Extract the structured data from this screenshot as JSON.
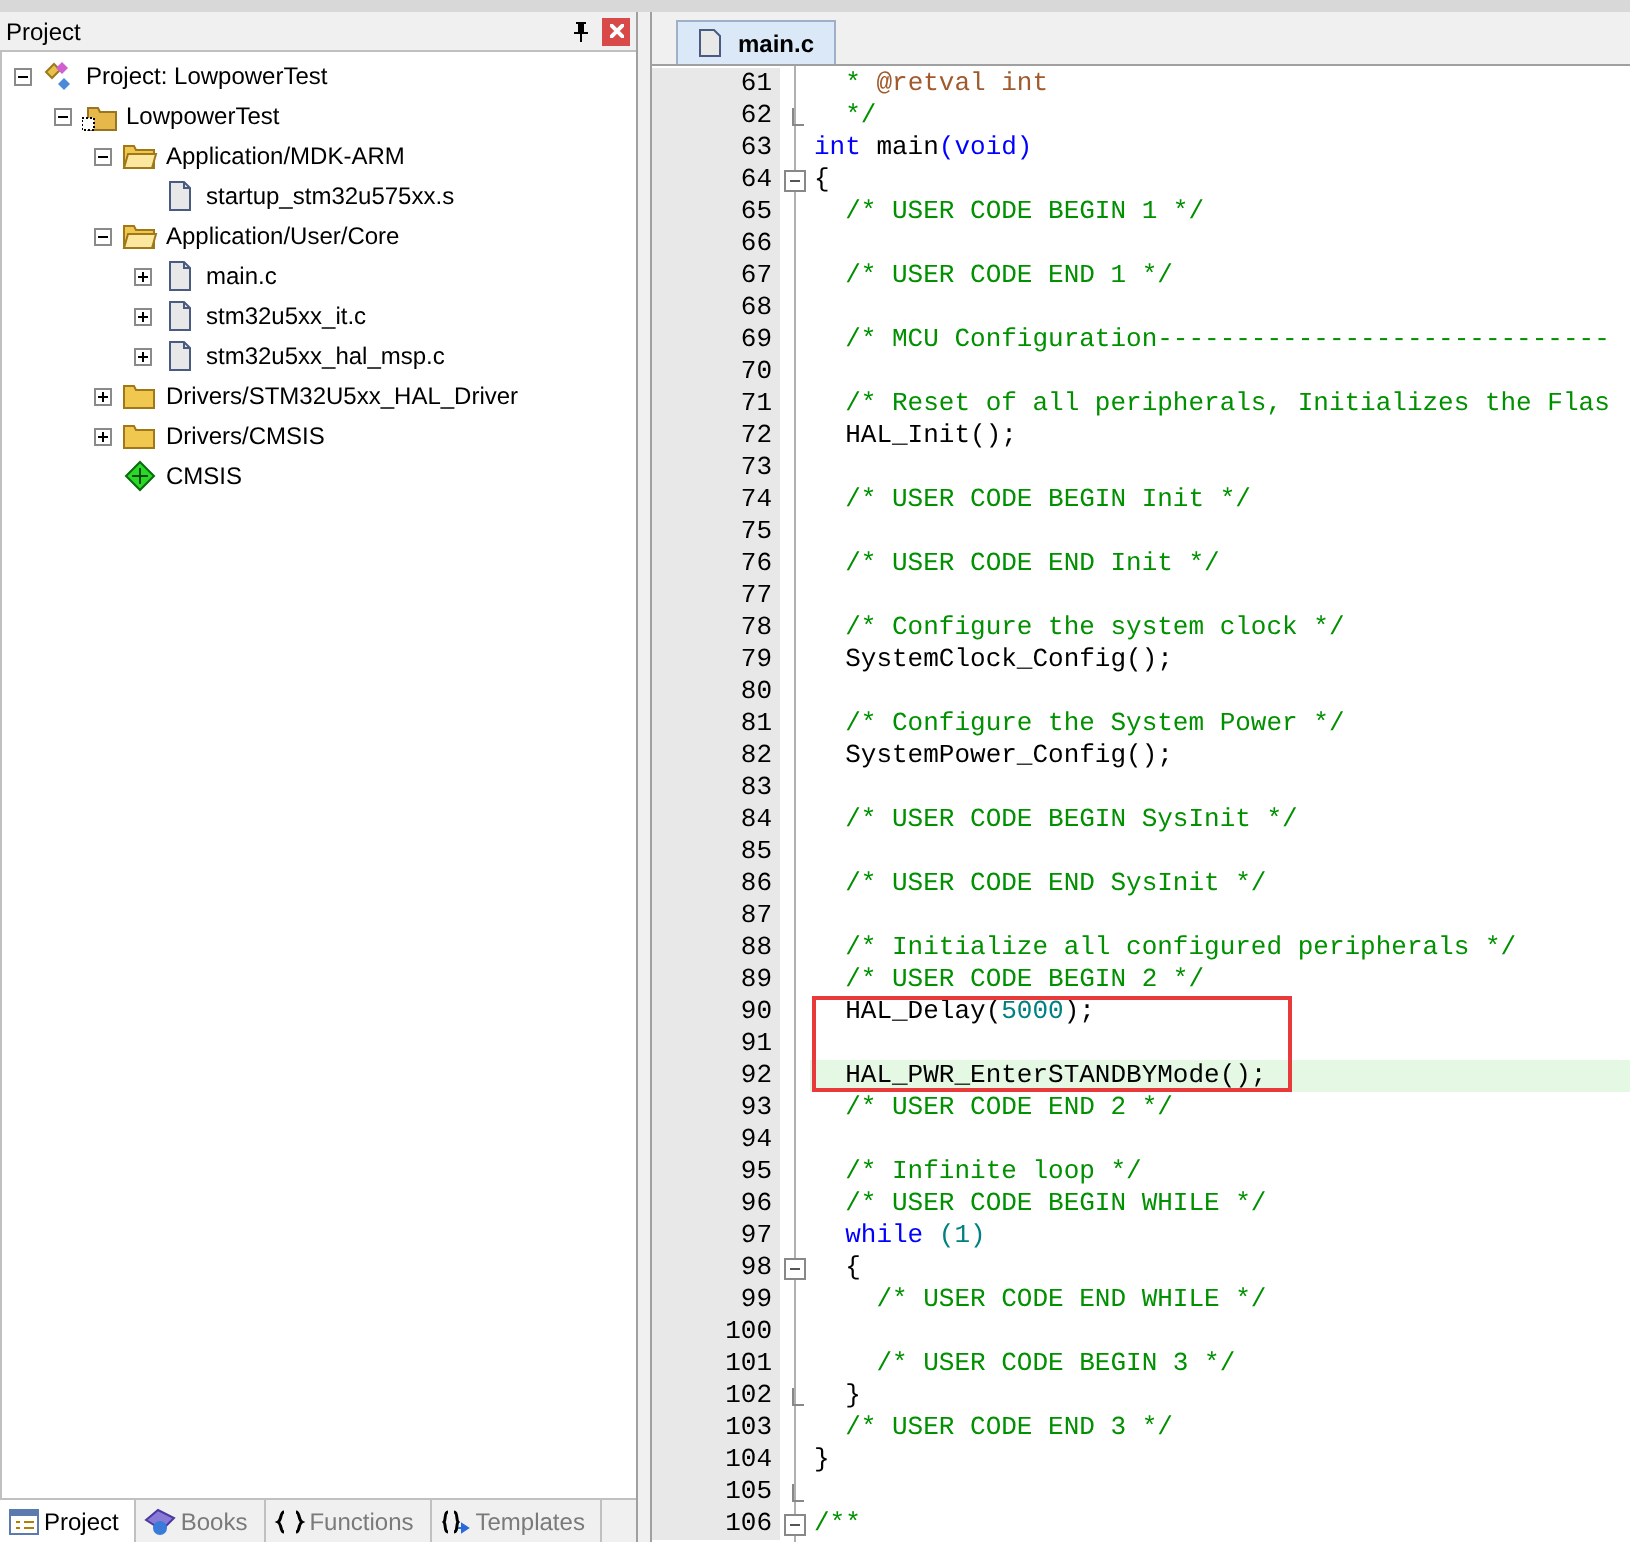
{
  "project_panel": {
    "title": "Project",
    "tree": [
      {
        "kind": "project",
        "label": "Project: LowpowerTest",
        "expanded": true,
        "children": [
          {
            "kind": "target",
            "label": "LowpowerTest",
            "expanded": true,
            "children": [
              {
                "kind": "group",
                "label": "Application/MDK-ARM",
                "expanded": true,
                "children": [
                  {
                    "kind": "file",
                    "label": "startup_stm32u575xx.s"
                  }
                ]
              },
              {
                "kind": "group",
                "label": "Application/User/Core",
                "expanded": true,
                "children": [
                  {
                    "kind": "file",
                    "label": "main.c",
                    "expanded": false
                  },
                  {
                    "kind": "file",
                    "label": "stm32u5xx_it.c",
                    "expanded": false
                  },
                  {
                    "kind": "file",
                    "label": "stm32u5xx_hal_msp.c",
                    "expanded": false
                  }
                ]
              },
              {
                "kind": "group",
                "label": "Drivers/STM32U5xx_HAL_Driver",
                "expanded": false
              },
              {
                "kind": "group",
                "label": "Drivers/CMSIS",
                "expanded": false
              },
              {
                "kind": "component",
                "label": "CMSIS"
              }
            ]
          }
        ]
      }
    ],
    "tabs": [
      {
        "kind": "project",
        "label": "Project",
        "selected": true
      },
      {
        "kind": "books",
        "label": "Books",
        "selected": false
      },
      {
        "kind": "functions",
        "label": "Functions",
        "selected": false
      },
      {
        "kind": "templates",
        "label": "Templates",
        "selected": false
      }
    ]
  },
  "editor": {
    "tabs": [
      {
        "label": "main.c",
        "selected": true
      }
    ],
    "lines": [
      {
        "number": "61",
        "tokens": [
          {
            "kind": "comment",
            "text": "  * "
          },
          {
            "kind": "doc",
            "text": "@retval int"
          }
        ]
      },
      {
        "number": "62",
        "fold_end": true,
        "tokens": [
          {
            "kind": "comment",
            "text": "  */"
          }
        ]
      },
      {
        "number": "63",
        "tokens": [
          {
            "kind": "keyword",
            "text": "int"
          },
          {
            "kind": "plain",
            "text": " main"
          },
          {
            "kind": "keyword",
            "text": "(void)"
          }
        ]
      },
      {
        "number": "64",
        "fold_start": true,
        "tokens": [
          {
            "kind": "plain",
            "text": "{"
          }
        ]
      },
      {
        "number": "65",
        "tokens": [
          {
            "kind": "comment",
            "text": "  /* USER CODE BEGIN 1 */"
          }
        ]
      },
      {
        "number": "66"
      },
      {
        "number": "67",
        "tokens": [
          {
            "kind": "comment",
            "text": "  /* USER CODE END 1 */"
          }
        ]
      },
      {
        "number": "68"
      },
      {
        "number": "69",
        "tokens": [
          {
            "kind": "comment",
            "text": "  /* MCU Configuration-----------------------------"
          }
        ]
      },
      {
        "number": "70"
      },
      {
        "number": "71",
        "tokens": [
          {
            "kind": "comment",
            "text": "  /* Reset of all peripherals, Initializes the Flas"
          }
        ]
      },
      {
        "number": "72",
        "tokens": [
          {
            "kind": "plain",
            "text": "  HAL_Init();"
          }
        ]
      },
      {
        "number": "73"
      },
      {
        "number": "74",
        "tokens": [
          {
            "kind": "comment",
            "text": "  /* USER CODE BEGIN Init */"
          }
        ]
      },
      {
        "number": "75"
      },
      {
        "number": "76",
        "tokens": [
          {
            "kind": "comment",
            "text": "  /* USER CODE END Init */"
          }
        ]
      },
      {
        "number": "77"
      },
      {
        "number": "78",
        "tokens": [
          {
            "kind": "comment",
            "text": "  /* Configure the system clock */"
          }
        ]
      },
      {
        "number": "79",
        "tokens": [
          {
            "kind": "plain",
            "text": "  SystemClock_Config();"
          }
        ]
      },
      {
        "number": "80"
      },
      {
        "number": "81",
        "tokens": [
          {
            "kind": "comment",
            "text": "  /* Configure the System Power */"
          }
        ]
      },
      {
        "number": "82",
        "tokens": [
          {
            "kind": "plain",
            "text": "  SystemPower_Config();"
          }
        ]
      },
      {
        "number": "83"
      },
      {
        "number": "84",
        "tokens": [
          {
            "kind": "comment",
            "text": "  /* USER CODE BEGIN SysInit */"
          }
        ]
      },
      {
        "number": "85"
      },
      {
        "number": "86",
        "tokens": [
          {
            "kind": "comment",
            "text": "  /* USER CODE END SysInit */"
          }
        ]
      },
      {
        "number": "87"
      },
      {
        "number": "88",
        "tokens": [
          {
            "kind": "comment",
            "text": "  /* Initialize all configured peripherals */"
          }
        ]
      },
      {
        "number": "89",
        "tokens": [
          {
            "kind": "comment",
            "text": "  /* USER CODE BEGIN 2 */"
          }
        ]
      },
      {
        "number": "90",
        "marked": true,
        "tokens": [
          {
            "kind": "plain",
            "text": "  HAL_Delay("
          },
          {
            "kind": "number",
            "text": "5000"
          },
          {
            "kind": "plain",
            "text": ");"
          }
        ]
      },
      {
        "number": "91",
        "marked": true
      },
      {
        "number": "92",
        "marked": true,
        "current": true,
        "tokens": [
          {
            "kind": "plain",
            "text": "  HAL_PWR_EnterSTANDBYMode();"
          }
        ]
      },
      {
        "number": "93",
        "tokens": [
          {
            "kind": "comment",
            "text": "  /* USER CODE END 2 */"
          }
        ]
      },
      {
        "number": "94"
      },
      {
        "number": "95",
        "tokens": [
          {
            "kind": "comment",
            "text": "  /* Infinite loop */"
          }
        ]
      },
      {
        "number": "96",
        "tokens": [
          {
            "kind": "comment",
            "text": "  /* USER CODE BEGIN WHILE */"
          }
        ]
      },
      {
        "number": "97",
        "tokens": [
          {
            "kind": "keyword",
            "text": "  while "
          },
          {
            "kind": "number",
            "text": "(1)"
          }
        ]
      },
      {
        "number": "98",
        "fold_start": true,
        "tokens": [
          {
            "kind": "plain",
            "text": "  {"
          }
        ]
      },
      {
        "number": "99",
        "tokens": [
          {
            "kind": "comment",
            "text": "    /* USER CODE END WHILE */"
          }
        ]
      },
      {
        "number": "100"
      },
      {
        "number": "101",
        "tokens": [
          {
            "kind": "comment",
            "text": "    /* USER CODE BEGIN 3 */"
          }
        ]
      },
      {
        "number": "102",
        "fold_end": true,
        "tokens": [
          {
            "kind": "plain",
            "text": "  }"
          }
        ]
      },
      {
        "number": "103",
        "tokens": [
          {
            "kind": "comment",
            "text": "  /* USER CODE END 3 */"
          }
        ]
      },
      {
        "number": "104",
        "tokens": [
          {
            "kind": "plain",
            "text": "}"
          }
        ]
      },
      {
        "number": "105",
        "fold_end": true
      },
      {
        "number": "106",
        "fold_start": true,
        "tokens": [
          {
            "kind": "comment",
            "text": "/**"
          }
        ]
      }
    ]
  }
}
